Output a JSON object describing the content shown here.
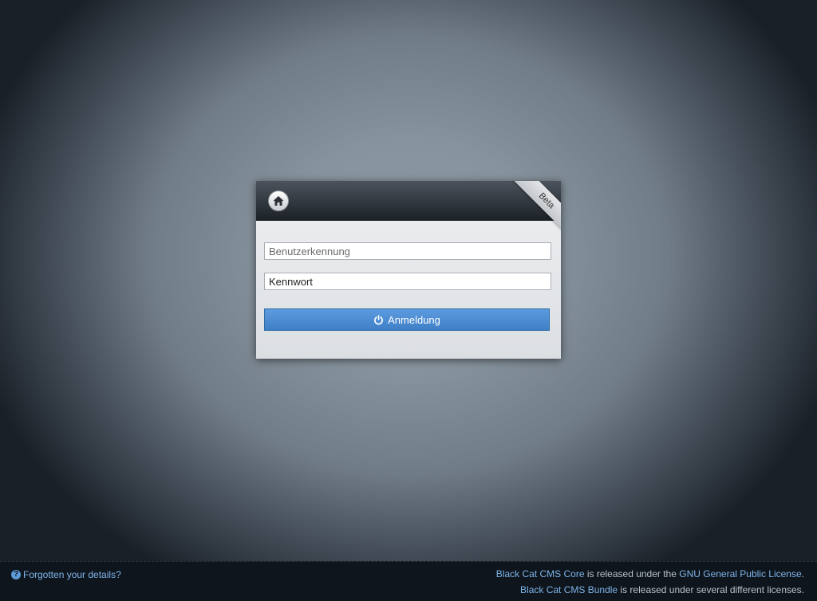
{
  "header": {
    "home_icon": "home-icon",
    "ribbon_label": "Beta"
  },
  "login": {
    "username_placeholder": "Benutzerkennung",
    "username_value": "",
    "password_value": "Kennwort",
    "submit_label": "Anmeldung",
    "submit_icon": "power-icon"
  },
  "footer": {
    "forgot_icon": "help-icon",
    "forgot_label": "Forgotten your details?",
    "license_line1": {
      "link1": "Black Cat CMS Core",
      "text": " is released under the ",
      "link2": "GNU General Public License",
      "suffix": "."
    },
    "license_line2": {
      "link1": "Black Cat CMS Bundle",
      "text": " is released under several different licenses."
    }
  },
  "colors": {
    "accent": "#4a8ad3",
    "link": "#7fb4ea",
    "header_dark": "#1c2127",
    "footer_bg": "#0e151c"
  }
}
